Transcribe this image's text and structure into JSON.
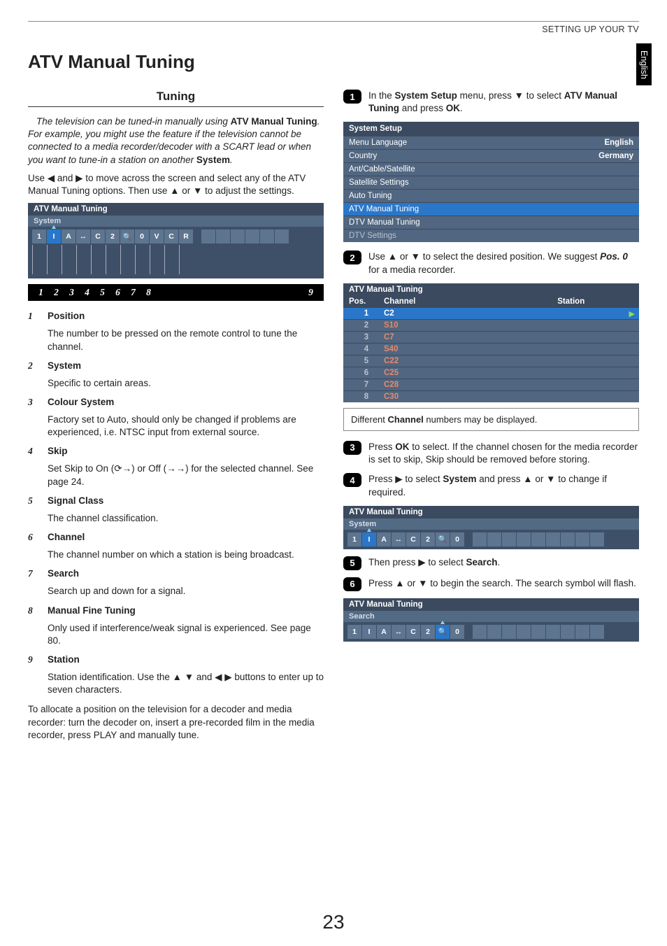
{
  "header": {
    "section": "SETTING UP YOUR TV"
  },
  "side_tab": "English",
  "page_title": "ATV Manual Tuning",
  "tuning_heading": "Tuning",
  "intro_html": "The television can be tuned-in manually using <b>ATV Manual Tuning</b>. For example, you might use the feature if the television cannot be connected to a media recorder/decoder with a SCART lead or when you want to tune-in a station on another <b>System</b>.",
  "use_arrows": "Use ◀ and ▶ to move across the screen and select any of the ATV Manual Tuning options. Then use ▲ or ▼ to adjust the settings.",
  "osd1": {
    "title": "ATV Manual Tuning",
    "sub": "System",
    "cells": [
      "1",
      "I",
      "A",
      "↔",
      "C",
      "2",
      "🔍",
      "0",
      "V",
      "C",
      "R"
    ],
    "highlight_index": 1,
    "legend": [
      "1",
      "2",
      "3",
      "4",
      "5",
      "6",
      "7",
      "8"
    ],
    "legend_last": "9"
  },
  "defs": [
    {
      "n": "1",
      "term": "Position",
      "body": "The number to be pressed on the remote control to tune the channel."
    },
    {
      "n": "2",
      "term": "System",
      "body": "Specific to certain areas."
    },
    {
      "n": "3",
      "term": "Colour System",
      "body": "Factory set to Auto, should only be changed if problems are experienced, i.e. NTSC input from external source."
    },
    {
      "n": "4",
      "term": "Skip",
      "body": "Set Skip to On (⟳→) or Off (→→) for the selected channel. See page 24."
    },
    {
      "n": "5",
      "term": "Signal Class",
      "body": "The channel classification."
    },
    {
      "n": "6",
      "term": "Channel",
      "body": "The channel number on which a station is being broadcast."
    },
    {
      "n": "7",
      "term": "Search",
      "body": "Search up and down for a signal."
    },
    {
      "n": "8",
      "term": "Manual Fine Tuning",
      "body": "Only used if interference/weak signal is experienced. See page 80."
    },
    {
      "n": "9",
      "term": "Station",
      "body": "Station identification. Use the ▲ ▼ and ◀ ▶ buttons to enter up to seven characters."
    }
  ],
  "alloc_text": "To allocate a position on the television for a decoder and media recorder: turn the decoder on, insert a pre-recorded film in the media recorder, press PLAY and manually tune.",
  "steps": {
    "s1_html": "In the <b>System Setup</b> menu, press ▼ to select <b>ATV Manual Tuning</b> and press <b>OK</b>.",
    "s2_html": "Use ▲ or ▼ to select the desired position. We suggest <b><i>Pos. 0</i></b> for a media recorder.",
    "s3_html": "Press <b>OK</b> to select. If the channel chosen for the media recorder is set to skip, Skip should be removed before storing.",
    "s4_html": "Press ▶ to select <b>System</b> and press ▲ or ▼ to change if required.",
    "s5_html": "Then press ▶ to select <b>Search</b>.",
    "s6_html": "Press ▲ or ▼ to begin the search. The search symbol will flash."
  },
  "system_setup": {
    "title": "System Setup",
    "rows": [
      {
        "label": "Menu Language",
        "value": "English",
        "selected": false
      },
      {
        "label": "Country",
        "value": "Germany",
        "selected": false
      },
      {
        "label": "Ant/Cable/Satellite",
        "value": "",
        "selected": false
      },
      {
        "label": "Satellite Settings",
        "value": "",
        "selected": false
      },
      {
        "label": "Auto Tuning",
        "value": "",
        "selected": false
      },
      {
        "label": "ATV Manual Tuning",
        "value": "",
        "selected": true
      },
      {
        "label": "DTV Manual Tuning",
        "value": "",
        "selected": false
      },
      {
        "label": "DTV Settings",
        "value": "",
        "selected": false,
        "dim": true
      }
    ]
  },
  "chan_table": {
    "title": "ATV Manual Tuning",
    "head": {
      "c1": "Pos.",
      "c2": "Channel",
      "c3": "Station"
    },
    "rows": [
      {
        "pos": "1",
        "ch": "C2",
        "sel": true
      },
      {
        "pos": "2",
        "ch": "S10"
      },
      {
        "pos": "3",
        "ch": "C7"
      },
      {
        "pos": "4",
        "ch": "S40"
      },
      {
        "pos": "5",
        "ch": "C22"
      },
      {
        "pos": "6",
        "ch": "C25"
      },
      {
        "pos": "7",
        "ch": "C28"
      },
      {
        "pos": "8",
        "ch": "C30"
      }
    ]
  },
  "note_html": "Different <b>Channel</b> numbers may be displayed.",
  "osd2": {
    "title": "ATV Manual Tuning",
    "sub": "System",
    "cells": [
      "1",
      "I",
      "A",
      "↔",
      "C",
      "2",
      "🔍",
      "0"
    ],
    "highlight_index": 1
  },
  "osd3": {
    "title": "ATV Manual Tuning",
    "sub": "Search",
    "cells": [
      "1",
      "I",
      "A",
      "↔",
      "C",
      "2",
      "🔍",
      "0"
    ],
    "highlight_index": 6
  },
  "page_number": "23"
}
